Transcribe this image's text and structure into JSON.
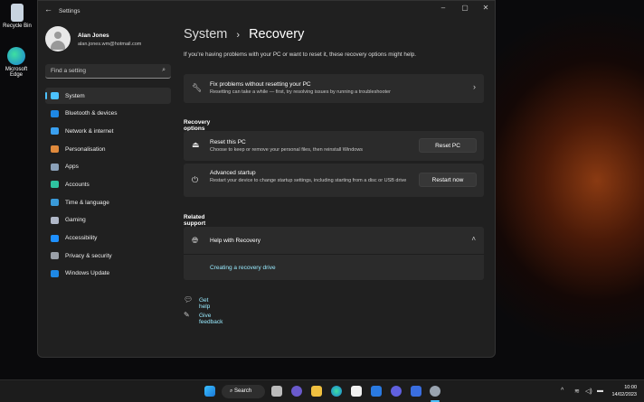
{
  "desktop": {
    "icons": [
      {
        "label": "Recycle Bin"
      },
      {
        "label": "Microsoft Edge"
      }
    ]
  },
  "window": {
    "title": "Settings",
    "controls": [
      "minimize",
      "maximize",
      "close"
    ]
  },
  "user": {
    "name": "Alan Jones",
    "email": "alan.jones.wm@hotmail.com"
  },
  "search": {
    "placeholder": "Find a setting"
  },
  "sidebar": {
    "items": [
      {
        "label": "System",
        "icon": "monitor-icon",
        "color": "#4cc2ff",
        "active": true
      },
      {
        "label": "Bluetooth & devices",
        "icon": "bluetooth-icon",
        "color": "#1e88e5"
      },
      {
        "label": "Network & internet",
        "icon": "wifi-icon",
        "color": "#3aa0f0"
      },
      {
        "label": "Personalisation",
        "icon": "brush-icon",
        "color": "#e08a3c"
      },
      {
        "label": "Apps",
        "icon": "apps-icon",
        "color": "#8aa0b8"
      },
      {
        "label": "Accounts",
        "icon": "person-icon",
        "color": "#2ec4a0"
      },
      {
        "label": "Time & language",
        "icon": "globe-clock-icon",
        "color": "#3a9ad9"
      },
      {
        "label": "Gaming",
        "icon": "gamepad-icon",
        "color": "#b0b8c8"
      },
      {
        "label": "Accessibility",
        "icon": "accessibility-icon",
        "color": "#1e90ff"
      },
      {
        "label": "Privacy & security",
        "icon": "shield-icon",
        "color": "#9aa0a8"
      },
      {
        "label": "Windows Update",
        "icon": "update-icon",
        "color": "#1e88e5"
      }
    ]
  },
  "main": {
    "breadcrumb_parent": "System",
    "breadcrumb_sep": "›",
    "title": "Recovery",
    "description": "If you're having problems with your PC or want to reset it, these recovery options might help.",
    "fix": {
      "title": "Fix problems without resetting your PC",
      "subtitle": "Resetting can take a while — first, try resolving issues by running a troubleshooter"
    },
    "recovery_options_label": "Recovery options",
    "reset": {
      "title": "Reset this PC",
      "subtitle": "Choose to keep or remove your personal files, then reinstall Windows",
      "button": "Reset PC"
    },
    "advanced": {
      "title": "Advanced startup",
      "subtitle": "Restart your device to change startup settings, including starting from a disc or USB drive",
      "button": "Restart now"
    },
    "related_label": "Related support",
    "help": {
      "title": "Help with Recovery",
      "link": "Creating a recovery drive"
    },
    "get_help": "Get help",
    "give_feedback": "Give feedback"
  },
  "taskbar": {
    "search_label": "Search",
    "time": "10:00",
    "date": "14/02/2023"
  }
}
